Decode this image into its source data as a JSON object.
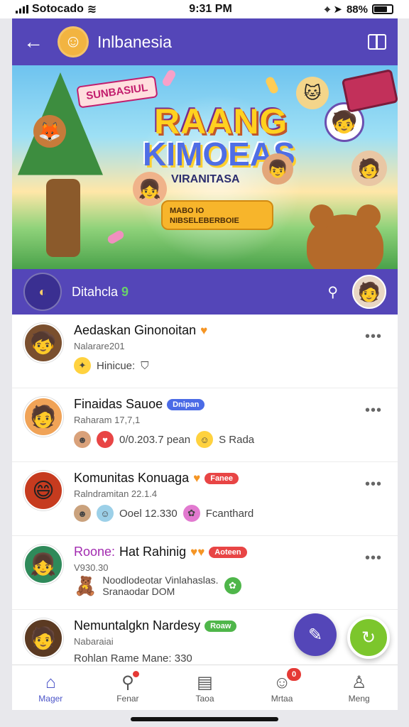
{
  "status_bar": {
    "carrier": "Sotocado",
    "time": "9:31 PM",
    "battery": "88%"
  },
  "header": {
    "title": "Inlbanesia",
    "avatar_icon": "smiley-face-icon"
  },
  "banner": {
    "tag": "SUNBASIUL",
    "headline_1": "RAANG",
    "headline_2": "KIMOEAS",
    "subline": "VIRANITASA",
    "cta": "MABO IO NIBSELEBERBOIE"
  },
  "section": {
    "title": "Ditahcla",
    "title_mark": "9"
  },
  "chats": [
    {
      "name": "Aedaskan Ginonoitan",
      "badge": "",
      "badge_color": "",
      "meta": "Nalarare201",
      "preview": "Hinicue:",
      "preview_icons": [
        "sparkle-icon",
        "shield-icon"
      ],
      "avatar_bg": "#7a4f2e"
    },
    {
      "name": "Finaidas Sauoe",
      "badge": "Dnipan",
      "badge_color": "#4b6be6",
      "meta": "Raharam 17,7,1",
      "preview": "0/0.203.7 pean",
      "preview_2": "S Rada",
      "preview_icons": [
        "avatar-mini-icon",
        "heart-icon"
      ],
      "avatar_bg": "#f0a357"
    },
    {
      "name": "Komunitas Konuaga",
      "badge": "Fanee",
      "badge_color": "#e84545",
      "meta": "Ralndramitan 22.1.4",
      "preview": "Ooel 12.330",
      "preview_2": "Fcanthard",
      "preview_icons": [
        "avatar-mini-icon",
        "avatar-mini-icon"
      ],
      "avatar_bg": "#c63b1f"
    },
    {
      "name": "Hat Rahinig",
      "name_prefix": "Roone:",
      "badge": "Aoteen",
      "badge_color": "#e84545",
      "meta": "V930.30",
      "preview": "Noodlodeotar Vinlahaslas.",
      "preview_2": "Sranaodar DOM",
      "preview_icons": [
        "teddy-bear-icon"
      ],
      "avatar_bg": "#2f8a5a"
    },
    {
      "name": "Nemuntalgkn Nardesy",
      "badge": "Roaw",
      "badge_color": "#4fb64a",
      "meta": "Nabaraiai",
      "preview": "Rohlan Rame Mane: 330",
      "preview_icons": [],
      "avatar_bg": "#5b3a22"
    }
  ],
  "fabs": [
    {
      "icon": "chat-icon"
    },
    {
      "icon": "refresh-icon"
    }
  ],
  "bottom_nav": [
    {
      "label": "Mager",
      "icon": "home-icon",
      "active": true
    },
    {
      "label": "Fenar",
      "icon": "search-icon",
      "active": false,
      "dot": true
    },
    {
      "label": "Taoa",
      "icon": "inbox-icon",
      "active": false
    },
    {
      "label": "Mrtaa",
      "icon": "people-icon",
      "active": false,
      "badge": "0"
    },
    {
      "label": "Meng",
      "icon": "profile-icon",
      "active": false
    }
  ],
  "colors": {
    "primary": "#5446b8",
    "accent_green": "#7cc62c",
    "badge_red": "#e84545",
    "badge_blue": "#4b6be6"
  }
}
